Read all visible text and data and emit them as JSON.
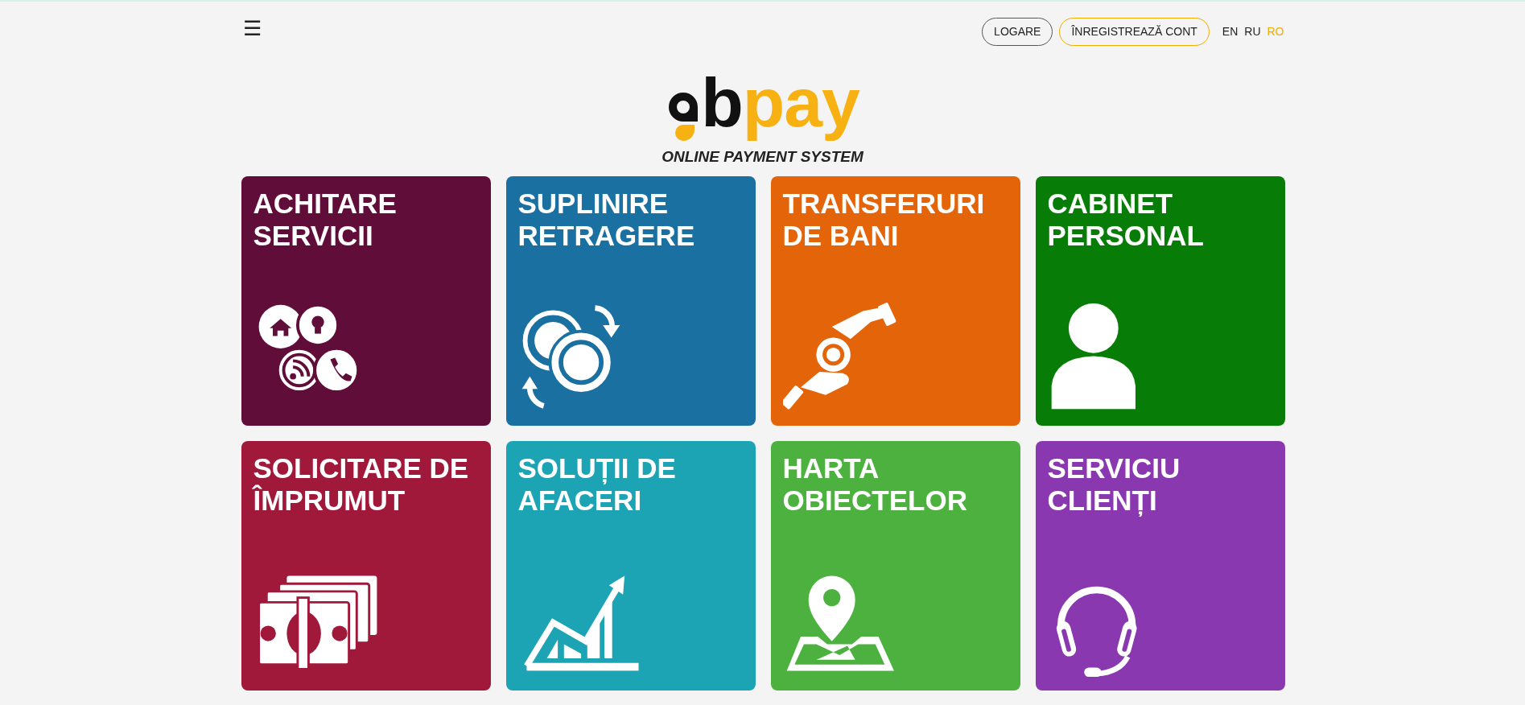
{
  "header": {
    "menu": "☰",
    "buttons": [
      {
        "label": "LOGARE",
        "kind": "login"
      },
      {
        "label": "ÎNREGISTREAZĂ CONT",
        "kind": "register"
      }
    ],
    "languages": [
      {
        "label": "EN",
        "selected": false
      },
      {
        "label": "RU",
        "selected": false
      },
      {
        "label": "RO",
        "selected": true
      }
    ]
  },
  "logo": {
    "text_dark": "b",
    "text_accent": "pay",
    "tagline": "ONLINE PAYMENT SYSTEM"
  },
  "tiles": [
    {
      "title": [
        "ACHITARE",
        "SERVICII"
      ],
      "color": "#600d3a",
      "kind": "services"
    },
    {
      "title": [
        "SUPLINIRE",
        "RETRAGERE"
      ],
      "color": "#1a71a1",
      "kind": "exchange"
    },
    {
      "title": [
        "TRANSFERURI",
        "DE BANI"
      ],
      "color": "#e4640a",
      "kind": "transfer"
    },
    {
      "title": [
        "CABINET",
        "PERSONAL"
      ],
      "color": "#077d07",
      "kind": "profile"
    },
    {
      "title": [
        "SOLICITARE DE",
        "ÎMPRUMUT"
      ],
      "color": "#a0193a",
      "kind": "loan"
    },
    {
      "title": [
        "SOLUȚII DE",
        "AFACERI"
      ],
      "color": "#1ca4b4",
      "kind": "business"
    },
    {
      "title": [
        "HARTA",
        "OBIECTELOR"
      ],
      "color": "#4db13f",
      "kind": "map"
    },
    {
      "title": [
        "SERVICIU",
        "CLIENȚI"
      ],
      "color": "#8a38b0",
      "kind": "support"
    }
  ]
}
